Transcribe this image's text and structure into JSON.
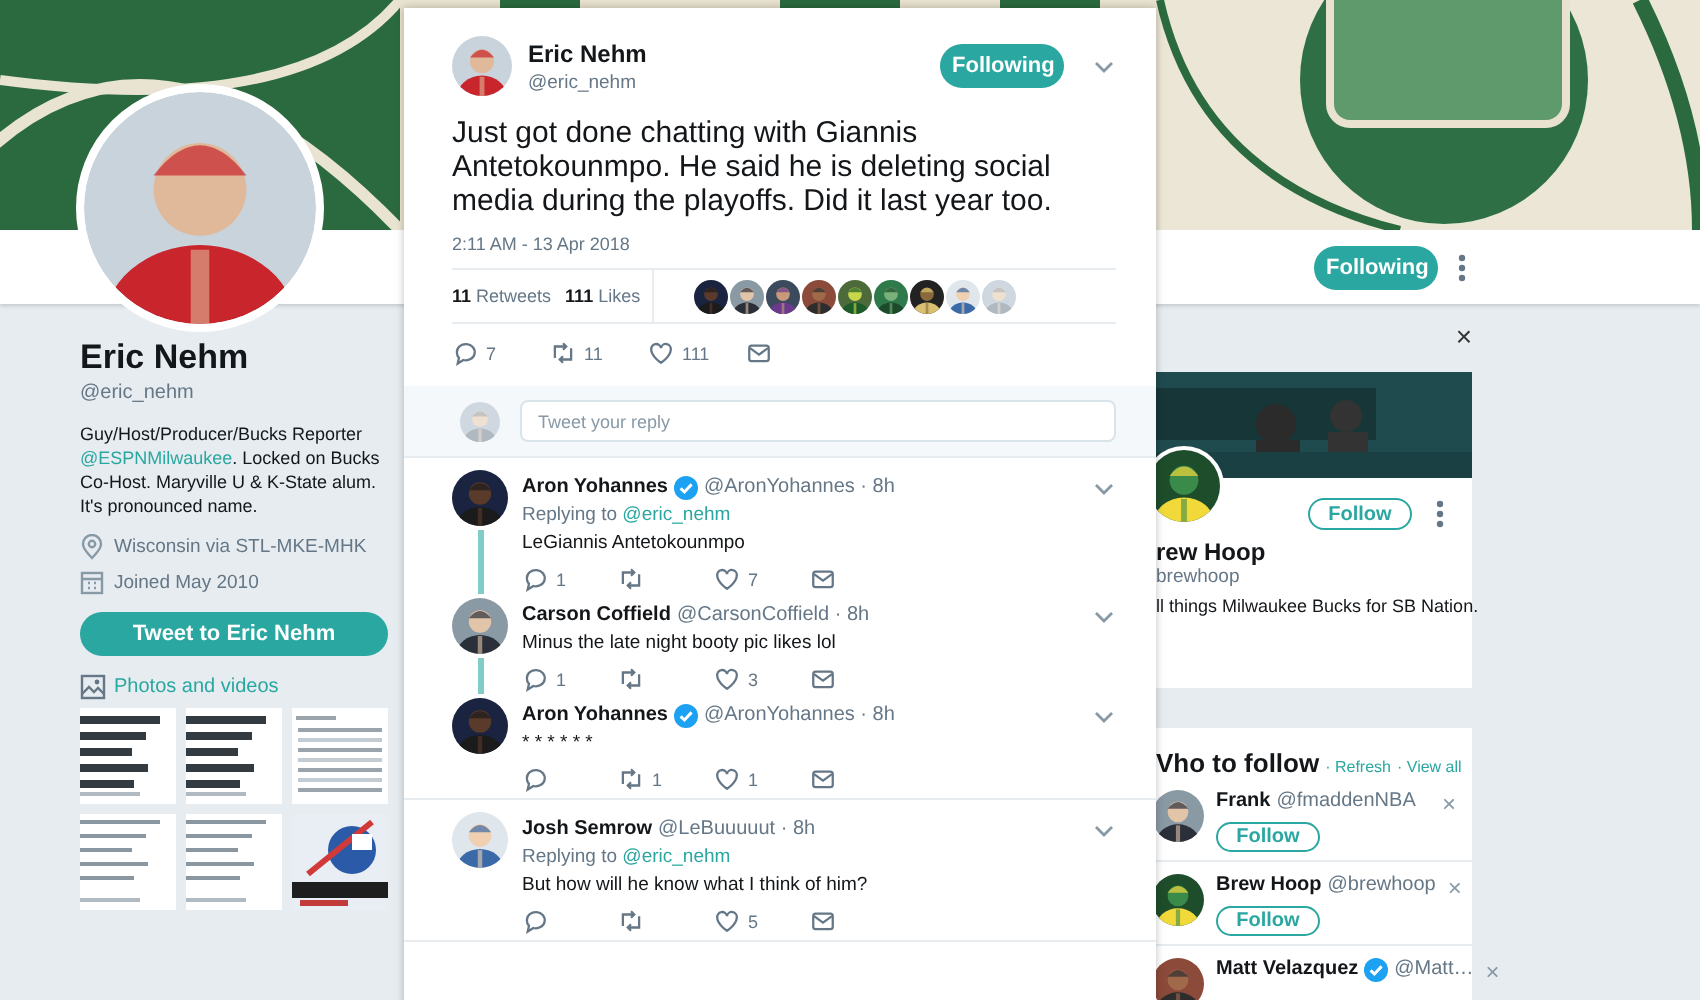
{
  "profile_nav": {
    "follow_button": "Following"
  },
  "profile": {
    "name": "Eric Nehm",
    "handle": "@eric_nehm",
    "bio": [
      {
        "text": "Guy/Host/Producer/Bucks Reporter "
      },
      {
        "link": "@ESPNMilwaukee"
      },
      {
        "text": ". Locked on Bucks Co-Host. Maryville U & K-State alum. It's pronounced name."
      }
    ],
    "location": "Wisconsin via STL-MKE-MHK",
    "joined": "Joined May 2010",
    "tweet_button": "Tweet to Eric Nehm",
    "media_heading": "Photos and videos"
  },
  "tweet": {
    "name": "Eric Nehm",
    "handle": "@eric_nehm",
    "follow_button": "Following",
    "text": "Just got done chatting with Giannis Antetokounmpo. He said he is deleting social media during the playoffs. Did it last year too.",
    "timestamp": "2:11 AM - 13 Apr 2018",
    "stats": [
      {
        "count": "11",
        "label": "Retweets"
      },
      {
        "count": "111",
        "label": "Likes"
      }
    ],
    "actions": {
      "replies": "7",
      "retweets": "11",
      "likes": "111"
    }
  },
  "reply_box": {
    "placeholder": "Tweet your reply"
  },
  "threads": [
    {
      "tweets": [
        {
          "name": "Aron Yohannes",
          "verified": true,
          "meta": "@AronYohannes · 8h",
          "replying_label": "Replying to",
          "replying_to": "@eric_nehm",
          "text": "LeGiannis Antetokounmpo",
          "actions": {
            "replies": "1",
            "likes": "7"
          }
        },
        {
          "name": "Carson Coffield",
          "verified": false,
          "meta": "@CarsonCoffield · 8h",
          "text": "Minus the late night booty pic likes lol",
          "actions": {
            "replies": "1",
            "likes": "3"
          }
        },
        {
          "name": "Aron Yohannes",
          "verified": true,
          "meta": "@AronYohannes · 8h",
          "text": "* * * * * *",
          "actions": {
            "retweets": "1",
            "likes": "1"
          }
        }
      ]
    },
    {
      "tweets": [
        {
          "name": "Josh Semrow",
          "verified": false,
          "meta": "@LeBuuuuut · 8h",
          "replying_label": "Replying to",
          "replying_to": "@eric_nehm",
          "text": "But how will he know what I think of him?",
          "actions": {
            "likes": "5"
          }
        }
      ]
    }
  ],
  "suggested_card": {
    "dismiss": "×",
    "follow_button": "Follow",
    "name": "rew Hoop",
    "handle": "brewhoop",
    "bio": "ll things Milwaukee Bucks for SB Nation."
  },
  "who_to_follow": {
    "heading": "Vho to follow",
    "links": [
      "· Refresh",
      "· View all"
    ],
    "suggestions": [
      {
        "name": "Frank",
        "verified": false,
        "handle": "@fmaddenNBA",
        "follow_button": "Follow",
        "dismiss": "×"
      },
      {
        "name": "Brew Hoop",
        "verified": false,
        "handle": "@brewhoop",
        "follow_button": "Follow",
        "dismiss": "×"
      },
      {
        "name": "Matt Velazquez",
        "verified": true,
        "handle": "@Matt…",
        "dismiss": "×"
      }
    ]
  }
}
